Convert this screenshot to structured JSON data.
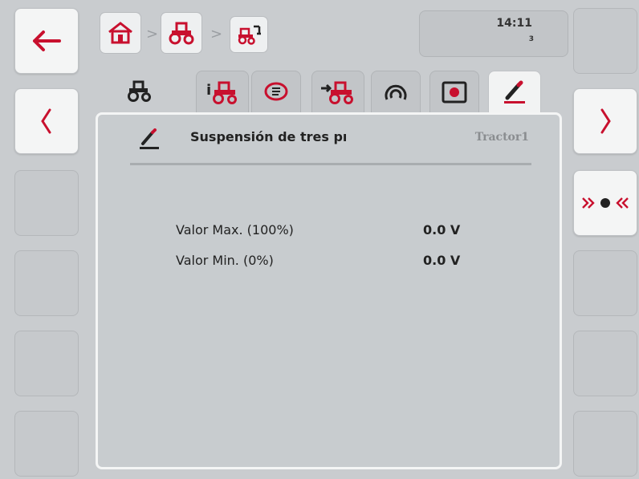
{
  "header": {
    "time": "14:11",
    "time_sub": "3",
    "breadcrumb_separators": [
      ">",
      ">"
    ],
    "breadcrumb_icons": [
      "home-icon",
      "tractor-icon",
      "tractor-implement-icon"
    ]
  },
  "tabs": [
    {
      "icon": "tractor-icon"
    },
    {
      "icon": "tractor-info-icon"
    },
    {
      "icon": "message-icon"
    },
    {
      "icon": "tractor-settings-icon"
    },
    {
      "icon": "gauge-icon"
    },
    {
      "icon": "hitch-icon"
    },
    {
      "icon": "calibrate-pen-icon"
    }
  ],
  "panel": {
    "title": "Suspensión de tres pı",
    "tractor_name": "Tractor1",
    "rows": [
      {
        "label": "Valor Max.  (100%)",
        "value": "0.0 V"
      },
      {
        "label": "Valor Min.  (0%)",
        "value": "0.0 V"
      }
    ]
  },
  "colors": {
    "accent_red": "#c8102e",
    "icon_dark": "#222222",
    "panel_bg": "#c8cccf"
  }
}
